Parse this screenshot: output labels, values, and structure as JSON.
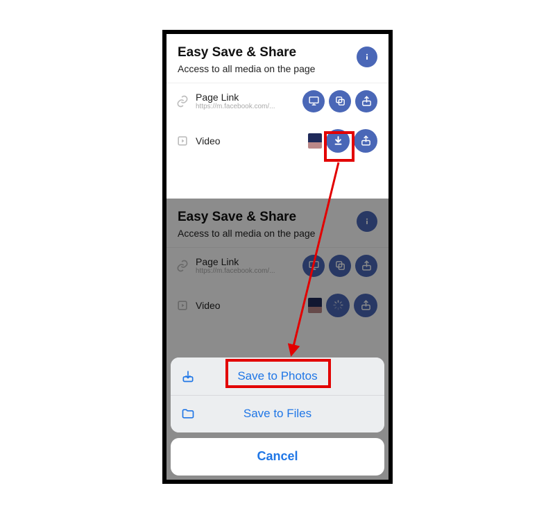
{
  "colors": {
    "accent": "#4a67b7",
    "ios_blue": "#1f76e6",
    "callout": "#e20000"
  },
  "panel1": {
    "title": "Easy Save & Share",
    "subtitle": "Access to all media on the page",
    "rows": {
      "link": {
        "label": "Page Link",
        "url": "https://m.facebook.com/..."
      },
      "video": {
        "label": "Video"
      }
    }
  },
  "panel2": {
    "title": "Easy Save & Share",
    "subtitle": "Access to all media on the page",
    "rows": {
      "link": {
        "label": "Page Link",
        "url": "https://m.facebook.com/..."
      },
      "video": {
        "label": "Video"
      }
    }
  },
  "sheet": {
    "save_photos": "Save to Photos",
    "save_files": "Save to Files",
    "cancel": "Cancel"
  }
}
